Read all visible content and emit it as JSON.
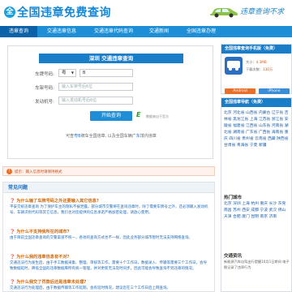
{
  "header": {
    "logo_mark": "全",
    "logo_text": "全国违章免费查询",
    "slogan": "违章查询不求"
  },
  "nav": {
    "items": [
      {
        "label": "违章查询",
        "active": true
      },
      {
        "label": "交通违章信息"
      },
      {
        "label": "交通违章代码查询"
      },
      {
        "label": "交通新闻"
      },
      {
        "label": "全国违章办理"
      }
    ]
  },
  "form": {
    "title": "深圳 交通违章查询",
    "plate_label": "车牌号码:",
    "plate_province": "粤",
    "plate_letter": "B",
    "frame_label": "车架号码:",
    "frame_placeholder": "输入车架号后6位",
    "engine_label": "发动机号:",
    "engine_placeholder": "输入发动机号后6位",
    "submit_label": "开始查询",
    "badge_e": "E",
    "badge_text": "数据来自于官方",
    "note_prefix": "可查",
    "note_highlight": "粤B",
    "note_suffix": "牌车全国违章, 以及全国车辆",
    "note_highlight2": "广东",
    "note_end": "境内违章"
  },
  "tip": {
    "icon": "!",
    "text": "提示：输入信息时请保持格式"
  },
  "faq": {
    "title": "常见问题",
    "items": [
      {
        "q": "为什么输了车牌号码之外还要输入其它信息?",
        "a": "平安交统违章查询 为了保护车主的隐私不被泄露，部分城市交警将在查询违章时，除了需要车牌号之外，还必须输入发动机号、车辆识别代码等其它信息，我们也对您提供的信息承诺严格加密处理，请放心使用。"
      },
      {
        "q": "为什么不支持我所在的城市?",
        "a": "由于目前全国违章查询的交警渠道不统一，各地的查询方式也不一样，因此业务部分城市暂时无法支持网络查询。"
      },
      {
        "q": "为什么我的违章信息有不对?",
        "a": "交通违法行为发生后，由于手工数据采集、整理、审核等工作，需要十个工作日，数据录入、传输等需要三个工作日，会导致数据延时，降低全国的违章数据库所有统一管理，并对更新无法及时同步，因此可能会导致查询不到违章的情况。"
      },
      {
        "q": "为什么我交了罚款后还是违章未处理?",
        "a": "交通违法行为处理后，由于数据传输等工作延期，会有延时情况，建议您在三个工作日后上网查询。"
      }
    ]
  },
  "app": {
    "title": "全国违章查询手机版（免费）",
    "version_label": "大小：",
    "version_value": "4.3MB",
    "downloads_label": "下载次数：",
    "downloads_value": "130万",
    "android_label": "Android",
    "iphone_label": "iPhone"
  },
  "cities": {
    "title": "全国违章导航（免费）",
    "list": "北京 河北省 山西省 内蒙古 辽宁省 吉林省 黑龙江省 上海 江苏省 浙江省 安徽省 福建省 江西省 山东省 河南省 湖北省 湖南省 广东省 广西省 海南省 重庆 四川省 贵州省 云南省 西藏 陕西省 甘肃省 青海省 宁夏 新疆",
    "hot_title": "热门城市",
    "hot_list": "北京 深圳 上海 杭州 重庆 长沙 东莞 南昌 苏州 西安 成都 宁波 武汉 佛山 天津 合肥 厦门 昆明 南京 济南",
    "notice_title": "交通资讯",
    "notice_text": "新能源汽车自驾出行提醒10月1日期间 电子眼记录了违章行为"
  }
}
